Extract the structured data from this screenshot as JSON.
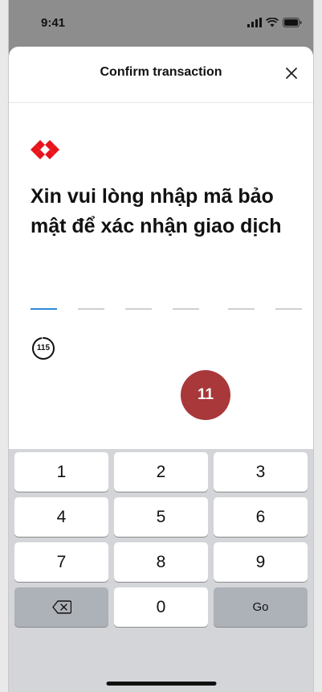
{
  "status_bar": {
    "time": "9:41"
  },
  "sheet": {
    "title": "Confirm transaction"
  },
  "heading": "Xin vui lòng nhập mã bảo mật để xác nhận giao dịch",
  "otp": {
    "slots": 6,
    "active_index": 0
  },
  "timer": {
    "seconds_left": "115",
    "progress": 0.96
  },
  "step_badge": "11",
  "keypad": {
    "keys": [
      "1",
      "2",
      "3",
      "4",
      "5",
      "6",
      "7",
      "8",
      "9"
    ],
    "zero": "0",
    "go_label": "Go",
    "delete_icon": "backspace-icon"
  },
  "colors": {
    "brand_red": "#e8141c",
    "badge_red": "#a8383a",
    "otp_active": "#2f8ad8"
  }
}
